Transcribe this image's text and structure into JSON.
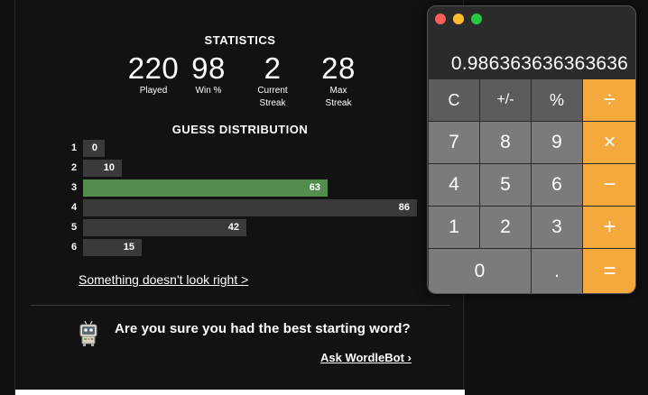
{
  "stats": {
    "title": "STATISTICS",
    "items": [
      {
        "value": "220",
        "label_line1": "Played",
        "label_line2": ""
      },
      {
        "value": "98",
        "label_line1": "Win %",
        "label_line2": ""
      },
      {
        "value": "2",
        "label_line1": "Current",
        "label_line2": "Streak"
      },
      {
        "value": "28",
        "label_line1": "Max",
        "label_line2": "Streak"
      }
    ]
  },
  "distribution": {
    "title": "GUESS DISTRIBUTION",
    "rows": [
      {
        "guess": "1",
        "count": 0,
        "label": "0",
        "current": false
      },
      {
        "guess": "2",
        "count": 10,
        "label": "10",
        "current": false
      },
      {
        "guess": "3",
        "count": 63,
        "label": "63",
        "current": true
      },
      {
        "guess": "4",
        "count": 86,
        "label": "86",
        "current": false
      },
      {
        "guess": "5",
        "count": 42,
        "label": "42",
        "current": false
      },
      {
        "guess": "6",
        "count": 15,
        "label": "15",
        "current": false
      }
    ],
    "max": 86,
    "colors": {
      "current": "#538d4e",
      "default": "#3a3a3c"
    }
  },
  "feedback_link": "Something doesn't look right >",
  "bot": {
    "icon": "wordlebot-icon",
    "question": "Are you sure you had the best starting word?",
    "link": "Ask WordleBot ›"
  },
  "calculator": {
    "display": "0.986363636363636",
    "lights": [
      {
        "name": "close",
        "color": "#fe5f57"
      },
      {
        "name": "minimize",
        "color": "#febc2e"
      },
      {
        "name": "zoom",
        "color": "#28c840"
      }
    ],
    "keys": {
      "clear": "C",
      "sign": "+/-",
      "percent": "%",
      "divide": "÷",
      "seven": "7",
      "eight": "8",
      "nine": "9",
      "multiply": "×",
      "four": "4",
      "five": "5",
      "six": "6",
      "subtract": "−",
      "one": "1",
      "two": "2",
      "three": "3",
      "add": "+",
      "zero": "0",
      "decimal": ".",
      "equals": "="
    },
    "colors": {
      "operator": "#f5a93c",
      "function": "#5c5c5c",
      "number": "#7b7b7b"
    }
  }
}
